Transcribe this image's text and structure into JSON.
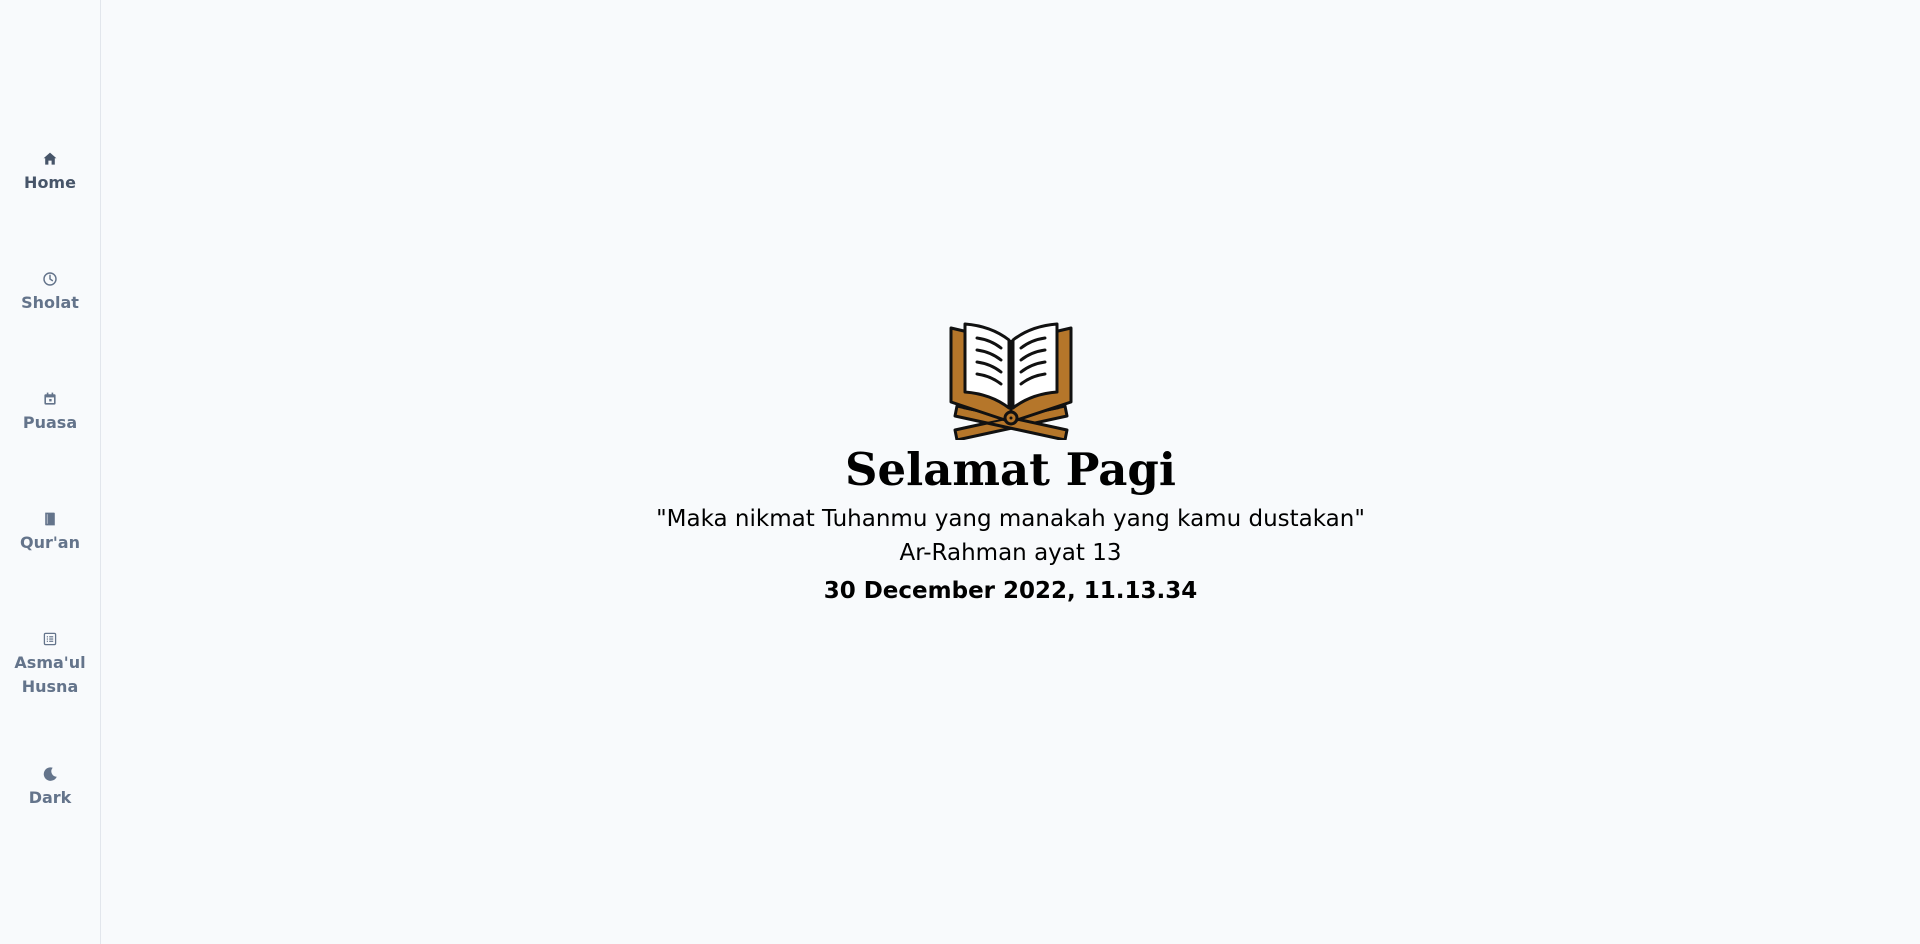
{
  "sidebar": {
    "items": [
      {
        "label": "Home",
        "icon": "home-icon"
      },
      {
        "label": "Sholat",
        "icon": "clock-icon"
      },
      {
        "label": "Puasa",
        "icon": "calendar-icon"
      },
      {
        "label": "Qur'an",
        "icon": "book-icon"
      },
      {
        "label": "Asma'ul Husna",
        "icon": "list-icon"
      },
      {
        "label": "Dark",
        "icon": "moon-icon"
      }
    ]
  },
  "hero": {
    "icon": "open-quran-icon",
    "greeting": "Selamat Pagi",
    "quote": "\"Maka nikmat Tuhanmu yang manakah yang kamu dustakan\"",
    "source": "Ar-Rahman ayat 13",
    "datetime": "30 December 2022, 11.13.34"
  },
  "colors": {
    "background": "#f8fafc",
    "nav_text": "#64748b",
    "book_brown": "#b5762a"
  }
}
